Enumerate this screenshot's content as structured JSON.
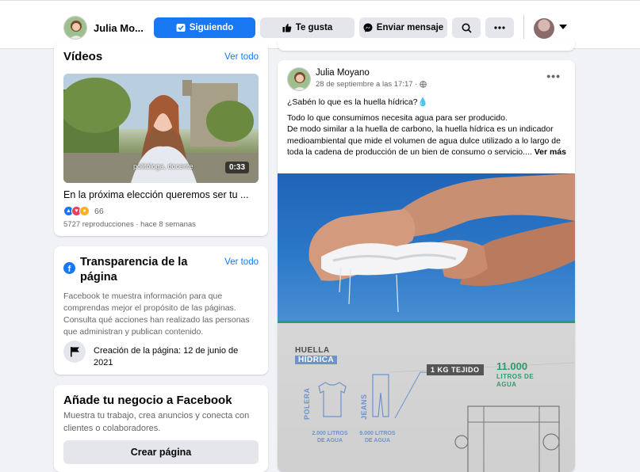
{
  "topbar": {
    "page_name": "Julia Mo...",
    "follow_label": "Siguiendo",
    "like_label": "Te gusta",
    "message_label": "Enviar mensaje"
  },
  "videos": {
    "heading": "Vídeos",
    "see_all": "Ver todo",
    "caption": "politóloga, docente",
    "duration": "0:33",
    "title": "En la próxima elección queremos ser tu ...",
    "reaction_count": "66",
    "meta": "5727 reproducciones · hace 8 semanas"
  },
  "transparency": {
    "heading": "Transparencia de la página",
    "see_all": "Ver todo",
    "body": "Facebook te muestra información para que comprendas mejor el propósito de las páginas. Consulta qué acciones han realizado las personas que administran y publican contenido.",
    "created": "Creación de la página: 12 de junio de 2021"
  },
  "business": {
    "heading": "Añade tu negocio a Facebook",
    "body": "Muestra tu trabajo, crea anuncios y conecta con clientes o colaboradores.",
    "button": "Crear página"
  },
  "post": {
    "author": "Julia Moyano",
    "date": "28 de septiembre a las 17:17 ·",
    "line1": "¿Sabén lo que es la huella hídrica?💧",
    "line2": "Todo lo que consumimos necesita agua para ser producido.",
    "line3": "De modo similar a la huella de carbono, la huella hídrica es un indicador medioambiental que mide el volumen de agua dulce utilizado a lo largo de toda la cadena de producción de un bien de consumo o servicio....",
    "see_more": "Ver más"
  },
  "infographic": {
    "title_top": "HUELLA",
    "title_bottom": "HÍDRICA",
    "polera": "POLERA",
    "jeans": "JEANS",
    "polera_liters": "2.000 LITROS DE AGUA",
    "jeans_liters": "9.000 LITROS DE AGUA",
    "kg": "1 KG TEJIDO",
    "big_number": "11.000",
    "big_sub": "LITROS DE AGUA"
  },
  "colors": {
    "accent": "#1877f2",
    "background": "#f0f2f5",
    "green": "#2c9c6a"
  }
}
